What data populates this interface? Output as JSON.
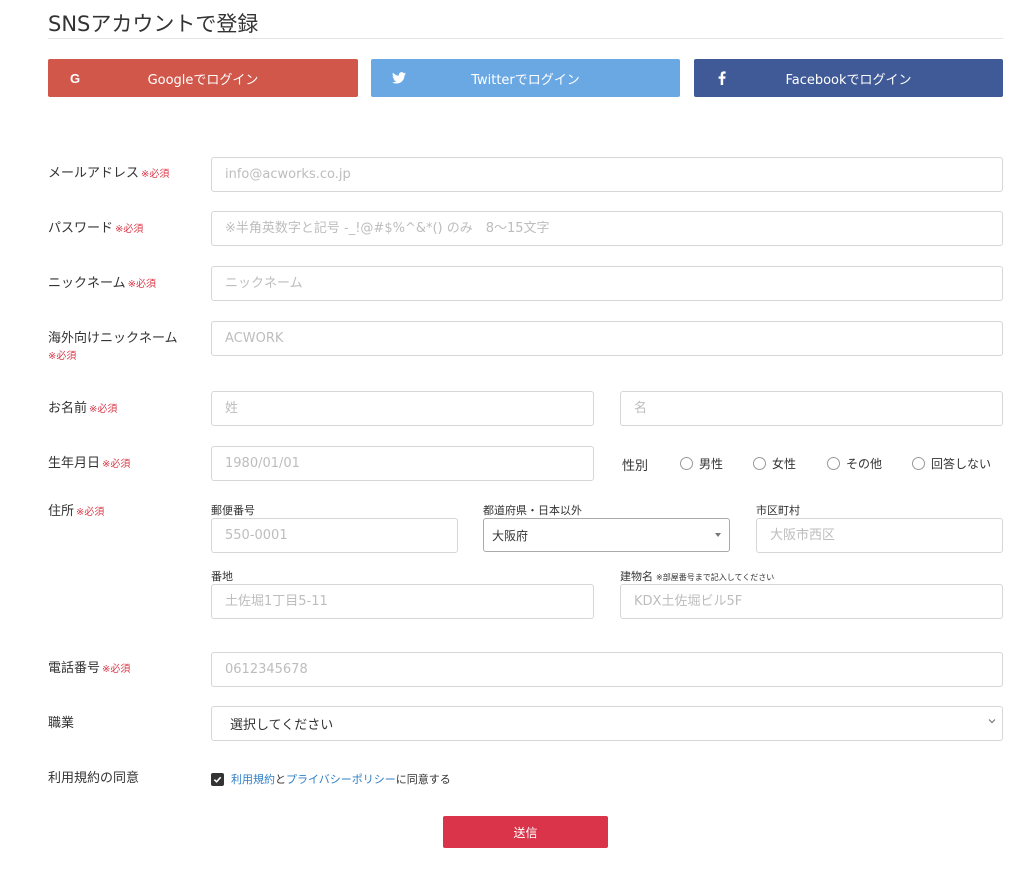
{
  "page_title": "SNSアカウントで登録",
  "sns": {
    "google_label": "Googleでログイン",
    "twitter_label": "Twitterでログイン",
    "facebook_label": "Facebookでログイン"
  },
  "required_mark": "※必須",
  "fields": {
    "email": {
      "label": "メールアドレス",
      "placeholder": "info@acworks.co.jp"
    },
    "password": {
      "label": "パスワード",
      "placeholder": "※半角英数字と記号 -_!@#$%^&*() のみ　8〜15文字"
    },
    "nickname": {
      "label": "ニックネーム",
      "placeholder": "ニックネーム"
    },
    "overseas_nickname": {
      "label": "海外向けニックネーム",
      "placeholder": "ACWORK"
    },
    "name": {
      "label": "お名前",
      "last_placeholder": "姓",
      "first_placeholder": "名"
    },
    "birthday": {
      "label": "生年月日",
      "placeholder": "1980/01/01"
    },
    "gender": {
      "label": "性別",
      "options": [
        "男性",
        "女性",
        "その他",
        "回答しない"
      ]
    },
    "address": {
      "label": "住所",
      "postal_label": "郵便番号",
      "postal_placeholder": "550-0001",
      "prefecture_label": "都道府県・日本以外",
      "prefecture_value": "大阪府",
      "city_label": "市区町村",
      "city_placeholder": "大阪市西区",
      "street_label": "番地",
      "street_placeholder": "土佐堀1丁目5-11",
      "building_label": "建物名",
      "building_note": "※部屋番号まで記入してください",
      "building_placeholder": "KDX土佐堀ビル5F"
    },
    "phone": {
      "label": "電話番号",
      "placeholder": "0612345678"
    },
    "job": {
      "label": "職業",
      "value": "選択してください"
    },
    "terms": {
      "label": "利用規約の同意",
      "checked": true,
      "link_terms": "利用規約",
      "connector": "と",
      "link_privacy": "プライバシーポリシー",
      "suffix": "に同意する"
    }
  },
  "submit_label": "送信",
  "colors": {
    "google": "#d0574a",
    "twitter": "#6aa8e4",
    "facebook": "#3f5a97",
    "required": "#d93a4a",
    "submit": "#d9344a",
    "link": "#2f7fc8"
  },
  "icons": {
    "google": "google-icon",
    "twitter": "twitter-icon",
    "facebook": "facebook-icon"
  }
}
